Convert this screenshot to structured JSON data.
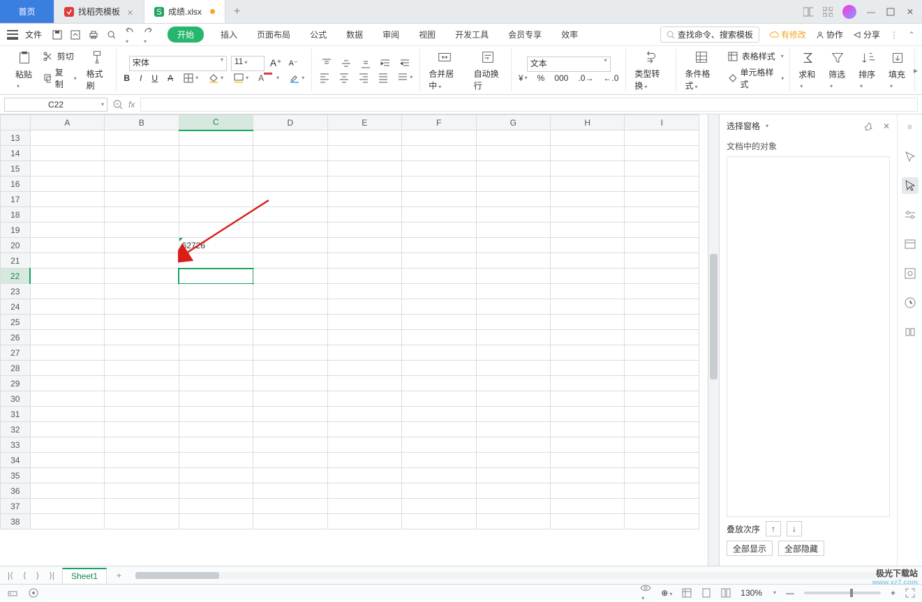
{
  "tabs": {
    "home": "首页",
    "template": "找稻壳模板",
    "file": "成绩.xlsx"
  },
  "menu": {
    "file": "文件",
    "start": "开始",
    "insert": "插入",
    "layout": "页面布局",
    "formula": "公式",
    "data": "数据",
    "review": "审阅",
    "view": "视图",
    "dev": "开发工具",
    "member": "会员专享",
    "efficiency": "效率"
  },
  "search": {
    "cmd": "查找命令、搜索模板"
  },
  "topright": {
    "changes": "有修改",
    "coop": "协作",
    "share": "分享"
  },
  "ribbon": {
    "paste": "粘贴",
    "cut": "剪切",
    "copy": "复制",
    "fmtpainter": "格式刷",
    "font": "宋体",
    "size": "11",
    "merge": "合并居中",
    "wrap": "自动换行",
    "numfmt": "文本",
    "typecvt": "类型转换",
    "condfmt": "条件格式",
    "tblstyle": "表格样式",
    "cellstyle": "单元格样式",
    "sum": "求和",
    "filter": "筛选",
    "sort": "排序",
    "fill": "填充"
  },
  "cellref": "C22",
  "columns": [
    "A",
    "B",
    "C",
    "D",
    "E",
    "F",
    "G",
    "H",
    "I"
  ],
  "rows": [
    13,
    14,
    15,
    16,
    17,
    18,
    19,
    20,
    21,
    22,
    23,
    24,
    25,
    26,
    27,
    28,
    29,
    30,
    31,
    32,
    33,
    34,
    35,
    36,
    37,
    38
  ],
  "cells": {
    "C20": "62726"
  },
  "selected": {
    "row": 22,
    "col": "C"
  },
  "pane": {
    "title": "选择窗格",
    "sub": "文档中的对象",
    "order": "叠放次序",
    "showall": "全部显示",
    "hideall": "全部隐藏"
  },
  "sheet": {
    "name": "Sheet1"
  },
  "status": {
    "zoom": "130%"
  },
  "watermark": {
    "name": "极光下载站",
    "url": "www.xz7.com"
  }
}
